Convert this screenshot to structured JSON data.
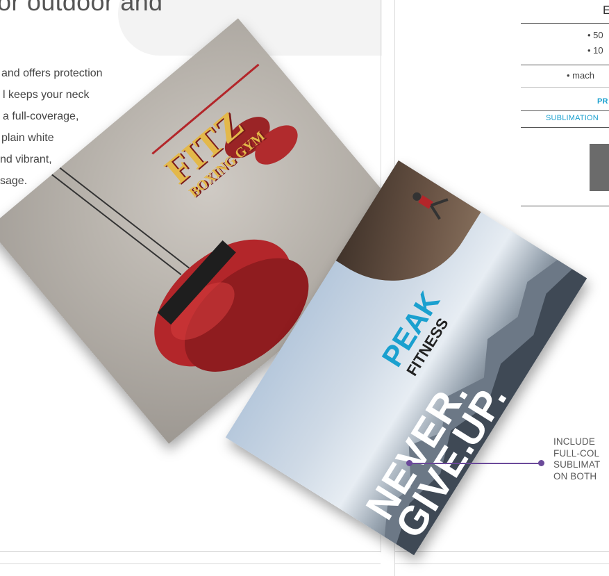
{
  "headline": "or outdoor and",
  "body_lines": [
    "and offers protection",
    "l keeps your neck",
    "a full-coverage,",
    "plain white",
    "nd vibrant,",
    "sage."
  ],
  "spec": {
    "title": "E",
    "line1": "• 50",
    "line2": "• 10",
    "line3": "• mach",
    "highlight1": "PR",
    "highlight2": "SUBLIMATION"
  },
  "callout_lines": [
    "INCLUDE",
    "FULL-COL",
    "SUBLIMAT",
    "ON BOTH"
  ],
  "towel_fitz": {
    "brand": "FITZ",
    "sub": "BOXING GYM"
  },
  "towel_peak": {
    "brand": "PEAK",
    "sub": "FITNESS",
    "slogan": [
      "NEVER.",
      "GIVE.",
      "UP."
    ]
  },
  "colors": {
    "accent_blue": "#1aa0cf",
    "callout_purple": "#6b4a9a",
    "glove_red": "#b3262a"
  }
}
